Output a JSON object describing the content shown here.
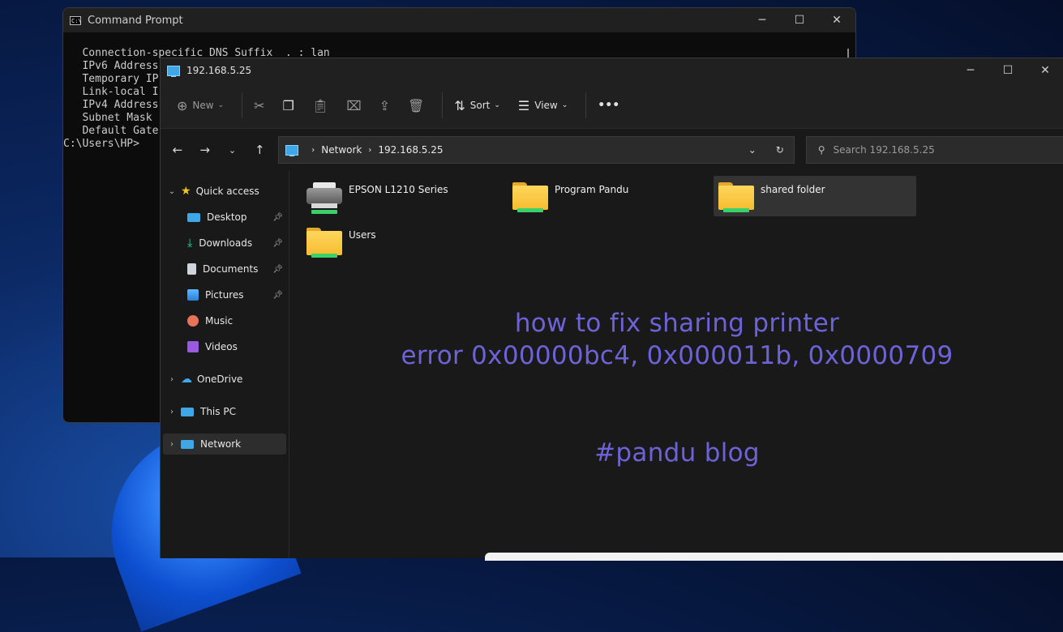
{
  "cmd": {
    "title": "Command Prompt",
    "lines": [
      "   Connection-specific DNS Suffix  . : lan",
      "   IPv6 Address",
      "   Temporary IP",
      "   Link-local I",
      "   IPv4 Address",
      "   Subnet Mask",
      "   Default Gate",
      "",
      "C:\\Users\\HP>"
    ]
  },
  "explorer": {
    "title": "192.168.5.25",
    "toolbar": {
      "new_label": "New",
      "sort_label": "Sort",
      "view_label": "View",
      "more_label": "•••"
    },
    "breadcrumb": [
      "Network",
      "192.168.5.25"
    ],
    "search_placeholder": "Search 192.168.5.25",
    "sidebar": {
      "quick_access": "Quick access",
      "items": [
        "Desktop",
        "Downloads",
        "Documents",
        "Pictures",
        "Music",
        "Videos"
      ],
      "onedrive": "OneDrive",
      "this_pc": "This PC",
      "network": "Network"
    },
    "files": [
      {
        "name": "EPSON L1210 Series",
        "type": "printer"
      },
      {
        "name": "Program Pandu",
        "type": "folder"
      },
      {
        "name": "shared folder",
        "type": "folder"
      },
      {
        "name": "Users",
        "type": "folder"
      }
    ]
  },
  "overlay": {
    "line1": "how to fix sharing printer",
    "line2": "error 0x00000bc4, 0x000011b, 0x0000709",
    "line3": "#pandu blog"
  },
  "colors": {
    "overlay_text": "#6c63d8",
    "folder": "#f5bd30",
    "network_strip": "#3ad06a"
  }
}
